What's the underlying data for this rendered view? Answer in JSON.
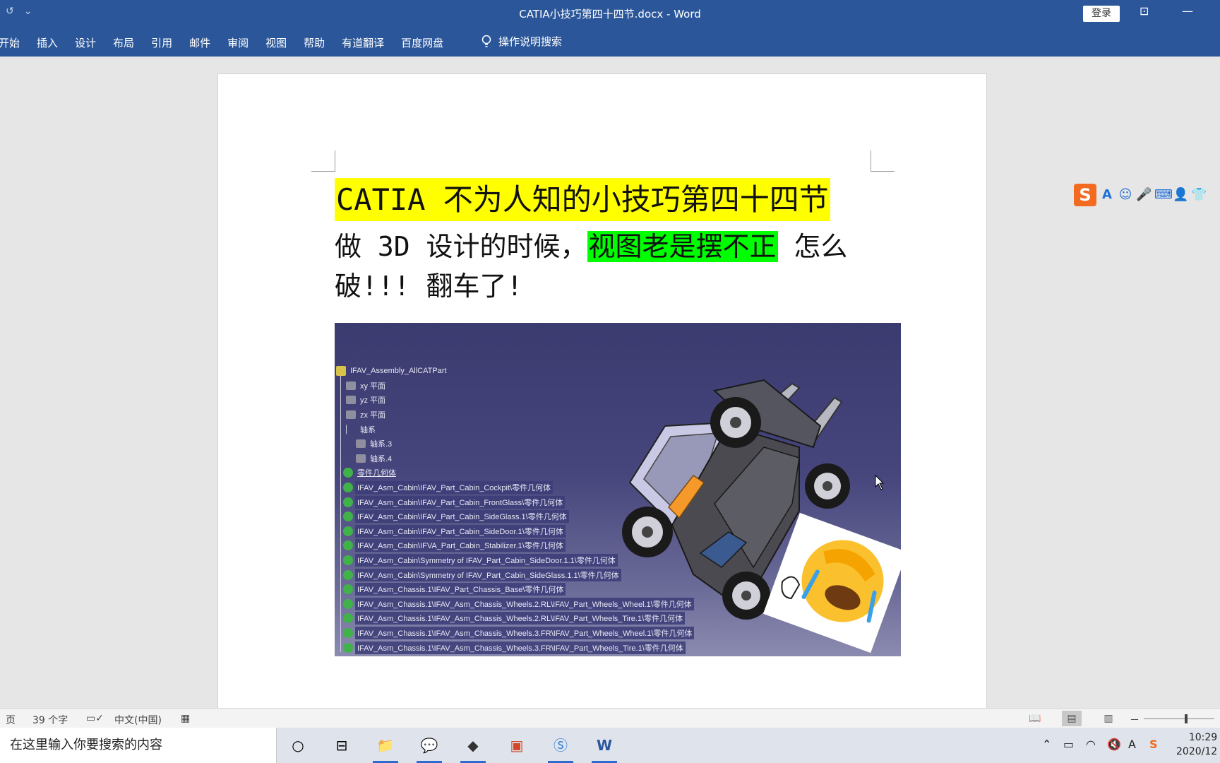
{
  "titlebar": {
    "qat_refresh": "↺",
    "qat_dropdown": "⌄",
    "title": "CATIA小技巧第四十四节.docx  -  Word",
    "login": "登录",
    "restore_glyph": "⊡",
    "minimize_glyph": "—"
  },
  "ribbon": {
    "tabs": [
      "开始",
      "插入",
      "设计",
      "布局",
      "引用",
      "邮件",
      "审阅",
      "视图",
      "帮助",
      "有道翻译",
      "百度网盘"
    ],
    "tell_me": "操作说明搜索"
  },
  "document": {
    "heading": "CATIA 不为人知的小技巧第四十四节",
    "body_pre": "做 3D 设计的时候，",
    "body_highlight": "视图老是摆不正",
    "body_post": " 怎么破!!!  翻车了!"
  },
  "catia_tree": {
    "root": "IFAV_Assembly_AllCATPart",
    "items": [
      "xy 平面",
      "yz 平面",
      "zx 平面",
      "轴系",
      "轴系.3",
      "轴系.4",
      "零件几何体",
      "IFAV_Asm_Cabin\\IFAV_Part_Cabin_Cockpit\\零件几何体",
      "IFAV_Asm_Cabin\\IFAV_Part_Cabin_FrontGlass\\零件几何体",
      "IFAV_Asm_Cabin\\IFAV_Part_Cabin_SideGlass.1\\零件几何体",
      "IFAV_Asm_Cabin\\IFAV_Part_Cabin_SideDoor.1\\零件几何体",
      "IFAV_Asm_Cabin\\IFVA_Part_Cabin_Stabilizer.1\\零件几何体",
      "IFAV_Asm_Cabin\\Symmetry of IFAV_Part_Cabin_SideDoor.1.1\\零件几何体",
      "IFAV_Asm_Cabin\\Symmetry of IFAV_Part_Cabin_SideGlass.1.1\\零件几何体",
      "IFAV_Asm_Chassis.1\\IFAV_Part_Chassis_Base\\零件几何体",
      "IFAV_Asm_Chassis.1\\IFAV_Asm_Chassis_Wheels.2.RL\\IFAV_Part_Wheels_Wheel.1\\零件几何体",
      "IFAV_Asm_Chassis.1\\IFAV_Asm_Chassis_Wheels.2.RL\\IFAV_Part_Wheels_Tire.1\\零件几何体",
      "IFAV_Asm_Chassis.1\\IFAV_Asm_Chassis_Wheels.3.FR\\IFAV_Part_Wheels_Wheel.1\\零件几何体",
      "IFAV_Asm_Chassis.1\\IFAV_Asm_Chassis_Wheels.3.FR\\IFAV_Part_Wheels_Tire.1\\零件几何体"
    ]
  },
  "ime": {
    "logo": "S",
    "icons": [
      "A",
      "☺",
      "🎤",
      "⌨",
      "👤",
      "👕"
    ]
  },
  "statusbar": {
    "page": "页",
    "word_count": "39 个字",
    "language": "中文(中国)",
    "zoom_minus": "－",
    "zoom_level": 0.6
  },
  "taskbar": {
    "search_placeholder": "在这里输入你要搜索的内容",
    "time": "10:29",
    "date": "2020/12"
  },
  "colors": {
    "word_blue": "#2b579a",
    "heading_highlight": "#ffff00",
    "body_highlight": "#00ff00"
  }
}
